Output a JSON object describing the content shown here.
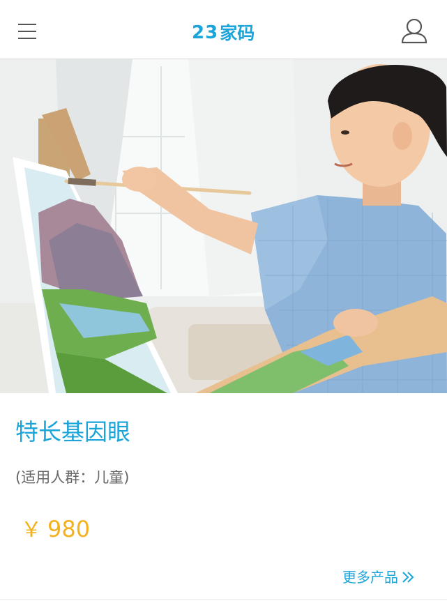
{
  "header": {
    "logo_digits": "23",
    "logo_text": "家码",
    "menu_icon": "hamburger-menu-icon",
    "user_icon": "user-profile-icon"
  },
  "hero": {
    "alt": "child-painting-photo"
  },
  "product": {
    "title": "特长基因眼",
    "audience": "(适用人群：儿童)",
    "currency": "￥",
    "price": "980"
  },
  "footer": {
    "more_label": "更多产品",
    "more_icon": "double-chevron-right-icon"
  },
  "colors": {
    "brand": "#1aa4da",
    "price": "#f3b21c",
    "muted_text": "#666666"
  }
}
